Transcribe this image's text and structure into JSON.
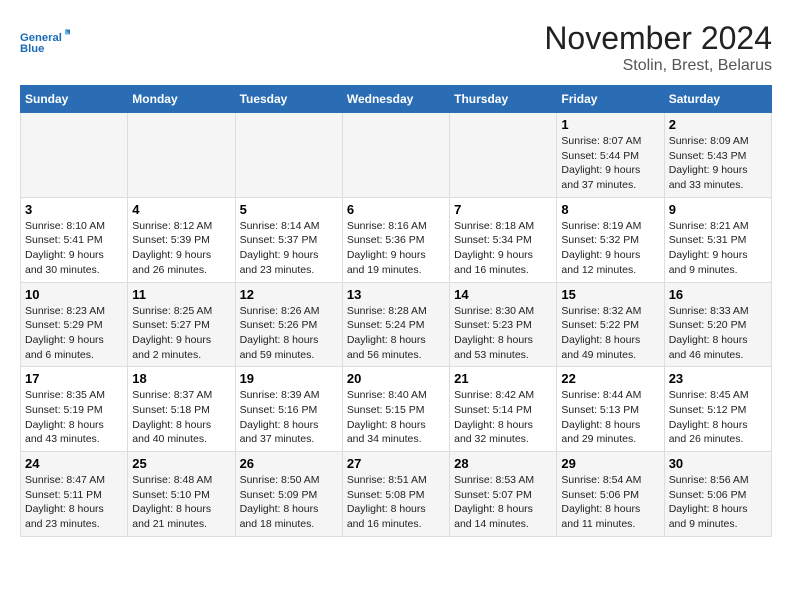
{
  "logo": {
    "line1": "General",
    "line2": "Blue"
  },
  "title": "November 2024",
  "subtitle": "Stolin, Brest, Belarus",
  "days_of_week": [
    "Sunday",
    "Monday",
    "Tuesday",
    "Wednesday",
    "Thursday",
    "Friday",
    "Saturday"
  ],
  "weeks": [
    [
      {
        "day": "",
        "info": ""
      },
      {
        "day": "",
        "info": ""
      },
      {
        "day": "",
        "info": ""
      },
      {
        "day": "",
        "info": ""
      },
      {
        "day": "",
        "info": ""
      },
      {
        "day": "1",
        "info": "Sunrise: 8:07 AM\nSunset: 5:44 PM\nDaylight: 9 hours and 37 minutes."
      },
      {
        "day": "2",
        "info": "Sunrise: 8:09 AM\nSunset: 5:43 PM\nDaylight: 9 hours and 33 minutes."
      }
    ],
    [
      {
        "day": "3",
        "info": "Sunrise: 8:10 AM\nSunset: 5:41 PM\nDaylight: 9 hours and 30 minutes."
      },
      {
        "day": "4",
        "info": "Sunrise: 8:12 AM\nSunset: 5:39 PM\nDaylight: 9 hours and 26 minutes."
      },
      {
        "day": "5",
        "info": "Sunrise: 8:14 AM\nSunset: 5:37 PM\nDaylight: 9 hours and 23 minutes."
      },
      {
        "day": "6",
        "info": "Sunrise: 8:16 AM\nSunset: 5:36 PM\nDaylight: 9 hours and 19 minutes."
      },
      {
        "day": "7",
        "info": "Sunrise: 8:18 AM\nSunset: 5:34 PM\nDaylight: 9 hours and 16 minutes."
      },
      {
        "day": "8",
        "info": "Sunrise: 8:19 AM\nSunset: 5:32 PM\nDaylight: 9 hours and 12 minutes."
      },
      {
        "day": "9",
        "info": "Sunrise: 8:21 AM\nSunset: 5:31 PM\nDaylight: 9 hours and 9 minutes."
      }
    ],
    [
      {
        "day": "10",
        "info": "Sunrise: 8:23 AM\nSunset: 5:29 PM\nDaylight: 9 hours and 6 minutes."
      },
      {
        "day": "11",
        "info": "Sunrise: 8:25 AM\nSunset: 5:27 PM\nDaylight: 9 hours and 2 minutes."
      },
      {
        "day": "12",
        "info": "Sunrise: 8:26 AM\nSunset: 5:26 PM\nDaylight: 8 hours and 59 minutes."
      },
      {
        "day": "13",
        "info": "Sunrise: 8:28 AM\nSunset: 5:24 PM\nDaylight: 8 hours and 56 minutes."
      },
      {
        "day": "14",
        "info": "Sunrise: 8:30 AM\nSunset: 5:23 PM\nDaylight: 8 hours and 53 minutes."
      },
      {
        "day": "15",
        "info": "Sunrise: 8:32 AM\nSunset: 5:22 PM\nDaylight: 8 hours and 49 minutes."
      },
      {
        "day": "16",
        "info": "Sunrise: 8:33 AM\nSunset: 5:20 PM\nDaylight: 8 hours and 46 minutes."
      }
    ],
    [
      {
        "day": "17",
        "info": "Sunrise: 8:35 AM\nSunset: 5:19 PM\nDaylight: 8 hours and 43 minutes."
      },
      {
        "day": "18",
        "info": "Sunrise: 8:37 AM\nSunset: 5:18 PM\nDaylight: 8 hours and 40 minutes."
      },
      {
        "day": "19",
        "info": "Sunrise: 8:39 AM\nSunset: 5:16 PM\nDaylight: 8 hours and 37 minutes."
      },
      {
        "day": "20",
        "info": "Sunrise: 8:40 AM\nSunset: 5:15 PM\nDaylight: 8 hours and 34 minutes."
      },
      {
        "day": "21",
        "info": "Sunrise: 8:42 AM\nSunset: 5:14 PM\nDaylight: 8 hours and 32 minutes."
      },
      {
        "day": "22",
        "info": "Sunrise: 8:44 AM\nSunset: 5:13 PM\nDaylight: 8 hours and 29 minutes."
      },
      {
        "day": "23",
        "info": "Sunrise: 8:45 AM\nSunset: 5:12 PM\nDaylight: 8 hours and 26 minutes."
      }
    ],
    [
      {
        "day": "24",
        "info": "Sunrise: 8:47 AM\nSunset: 5:11 PM\nDaylight: 8 hours and 23 minutes."
      },
      {
        "day": "25",
        "info": "Sunrise: 8:48 AM\nSunset: 5:10 PM\nDaylight: 8 hours and 21 minutes."
      },
      {
        "day": "26",
        "info": "Sunrise: 8:50 AM\nSunset: 5:09 PM\nDaylight: 8 hours and 18 minutes."
      },
      {
        "day": "27",
        "info": "Sunrise: 8:51 AM\nSunset: 5:08 PM\nDaylight: 8 hours and 16 minutes."
      },
      {
        "day": "28",
        "info": "Sunrise: 8:53 AM\nSunset: 5:07 PM\nDaylight: 8 hours and 14 minutes."
      },
      {
        "day": "29",
        "info": "Sunrise: 8:54 AM\nSunset: 5:06 PM\nDaylight: 8 hours and 11 minutes."
      },
      {
        "day": "30",
        "info": "Sunrise: 8:56 AM\nSunset: 5:06 PM\nDaylight: 8 hours and 9 minutes."
      }
    ]
  ]
}
